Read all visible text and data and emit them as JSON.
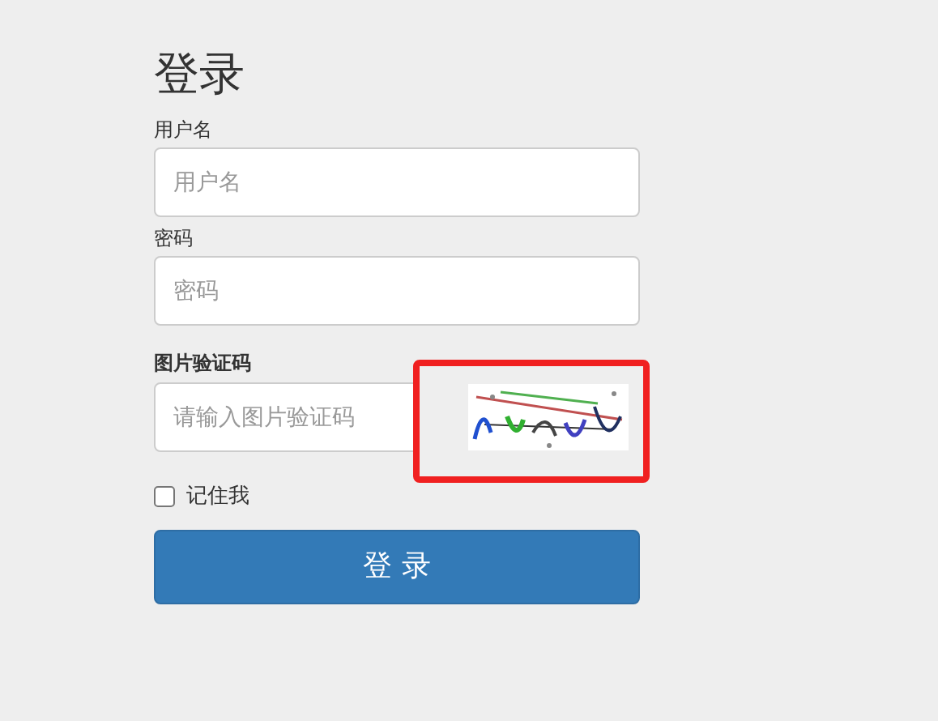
{
  "title": "登录",
  "fields": [
    {
      "label": "用户名",
      "placeholder": "用户名"
    },
    {
      "label": "密码",
      "placeholder": "密码"
    }
  ],
  "captcha": {
    "label": "图片验证码",
    "placeholder": "请输入图片验证码",
    "highlighted": true
  },
  "remember": {
    "label": "记住我",
    "checked": false
  },
  "submit_button": "登 录"
}
